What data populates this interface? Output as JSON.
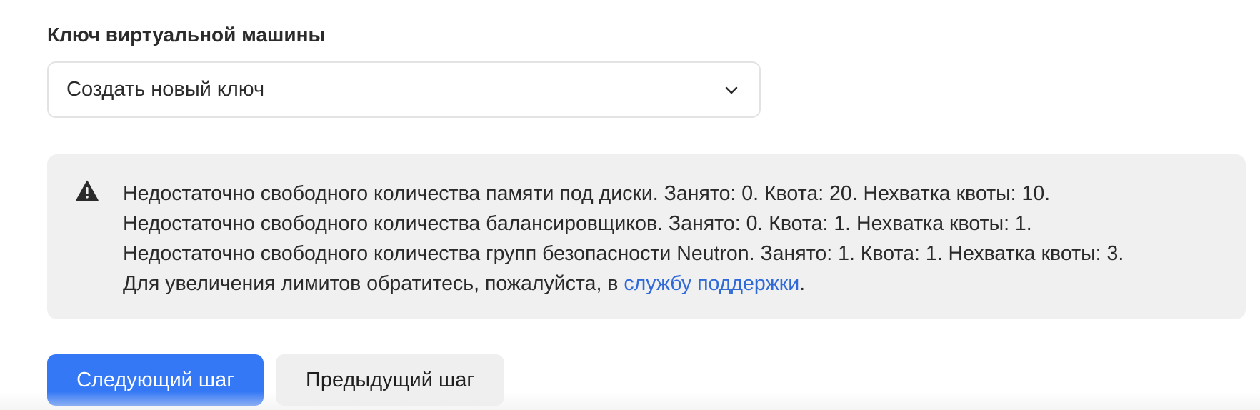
{
  "form": {
    "key_label": "Ключ виртуальной машины",
    "key_select": {
      "selected_value": "Создать новый ключ",
      "chevron_icon": "chevron-down-icon"
    }
  },
  "alert": {
    "icon": "warning-icon",
    "lines": [
      "Недостаточно свободного количества памяти под диски. Занято: 0. Квота: 20. Нехватка квоты: 10.",
      "Недостаточно свободного количества балансировщиков. Занято: 0. Квота: 1. Нехватка квоты: 1.",
      "Недостаточно свободного количества групп безопасности Neutron. Занято: 1. Квота: 1. Нехватка квоты: 3."
    ],
    "footer_prefix": "Для увеличения лимитов обратитесь, пожалуйста, в ",
    "footer_link": "службу поддержки",
    "footer_suffix": "."
  },
  "actions": {
    "next_label": "Следующий шаг",
    "prev_label": "Предыдущий шаг"
  },
  "colors": {
    "primary": "#3478f6",
    "link": "#2f6ad8",
    "alert_bg": "#f0f0f0",
    "secondary_bg": "#efefef"
  }
}
